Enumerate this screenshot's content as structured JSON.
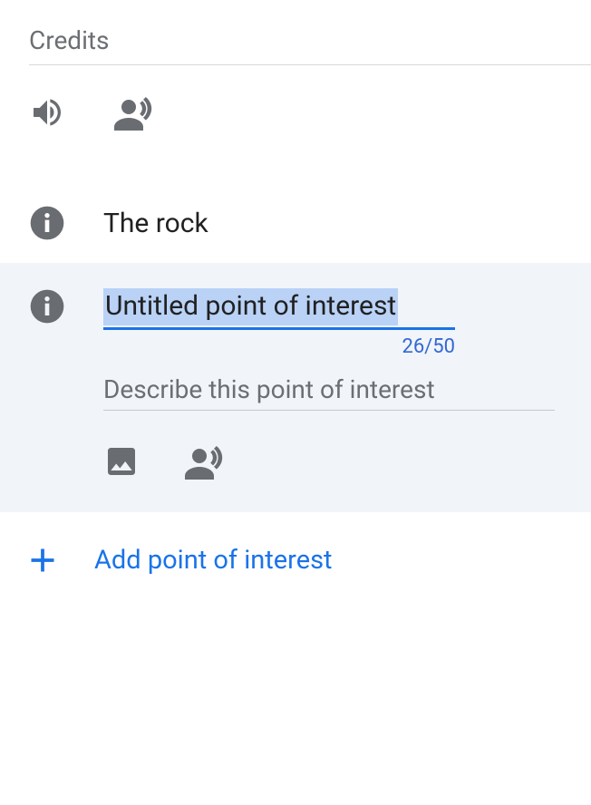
{
  "credits": {
    "label": "Credits"
  },
  "points": [
    {
      "title": "The rock"
    }
  ],
  "editing": {
    "title_value": "Untitled point of interest",
    "char_count": "26/50",
    "description_placeholder": "Describe this point of interest"
  },
  "add_action": {
    "label": "Add point of interest"
  },
  "colors": {
    "accent": "#1a73e8",
    "icon_muted": "#696d71",
    "text_muted": "#6b6f73",
    "card_bg": "#f1f4f9",
    "selection": "#b9d2f6"
  }
}
